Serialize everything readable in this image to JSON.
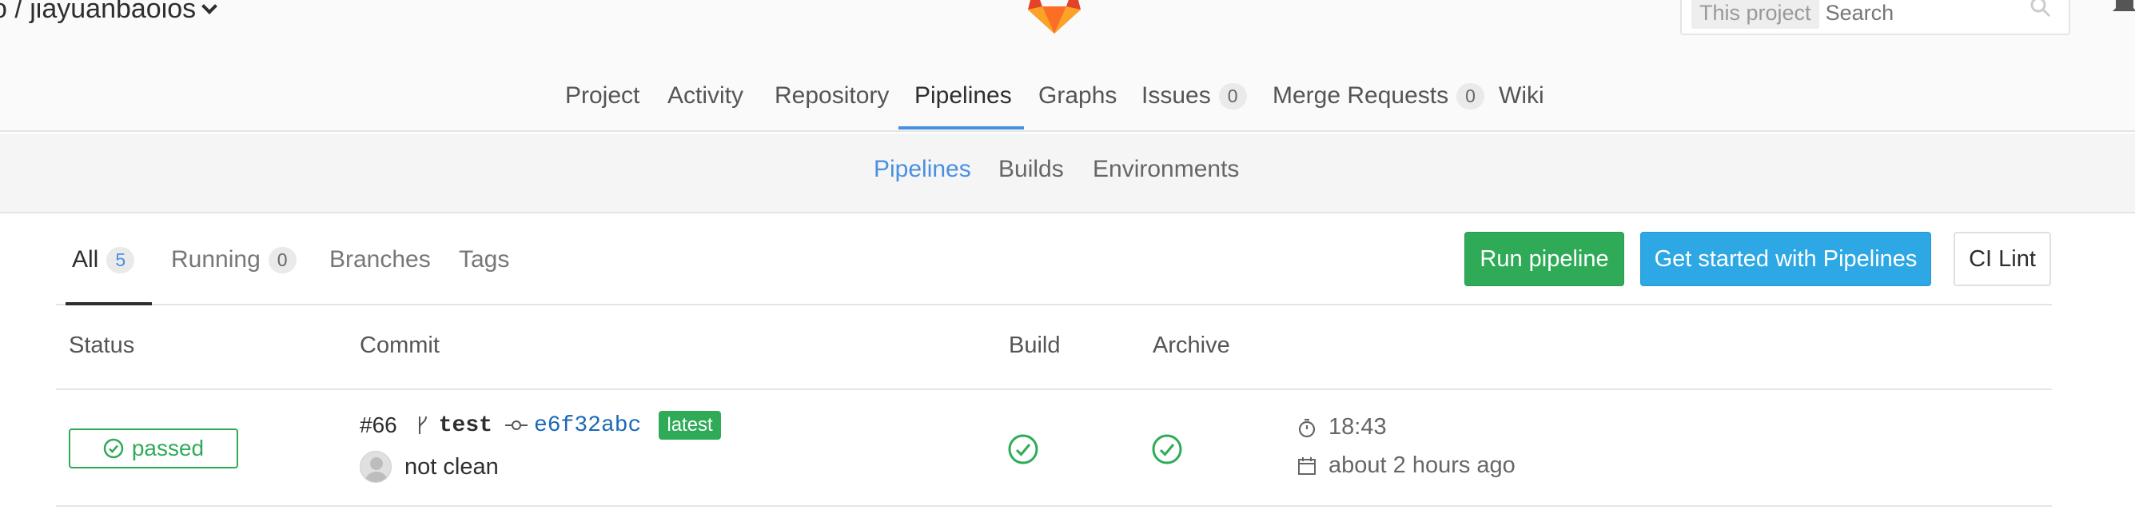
{
  "header": {
    "project_title": "o / jiayuanbaoios",
    "search": {
      "scope": "This project",
      "placeholder": "Search"
    }
  },
  "nav": {
    "items": [
      {
        "label": "Project"
      },
      {
        "label": "Activity"
      },
      {
        "label": "Repository"
      },
      {
        "label": "Pipelines",
        "active": true
      },
      {
        "label": "Graphs"
      },
      {
        "label": "Issues",
        "count": "0"
      },
      {
        "label": "Merge Requests",
        "count": "0"
      },
      {
        "label": "Wiki"
      }
    ]
  },
  "subnav": {
    "items": [
      {
        "label": "Pipelines",
        "active": true
      },
      {
        "label": "Builds"
      },
      {
        "label": "Environments"
      }
    ]
  },
  "tabs": {
    "items": [
      {
        "label": "All",
        "count": "5",
        "active": true
      },
      {
        "label": "Running",
        "count": "0"
      },
      {
        "label": "Branches"
      },
      {
        "label": "Tags"
      }
    ]
  },
  "actions": {
    "run_pipeline": "Run pipeline",
    "get_started": "Get started with Pipelines",
    "ci_lint": "CI Lint"
  },
  "table": {
    "headers": {
      "status": "Status",
      "commit": "Commit",
      "build": "Build",
      "archive": "Archive"
    },
    "rows": [
      {
        "status": "passed",
        "pipeline_id": "#66",
        "branch": "test",
        "sha": "e6f32abc",
        "badge": "latest",
        "message": "not clean",
        "stages": {
          "build": "passed",
          "archive": "passed"
        },
        "duration": "18:43",
        "finished": "about 2 hours ago"
      }
    ]
  },
  "colors": {
    "success": "#2fab58",
    "accent_blue": "#4a90e2",
    "info_button": "#2ea8e5",
    "sha_link": "#1b69b6"
  },
  "icons": [
    "gitlab-logo",
    "search-icon",
    "bell-icon",
    "chevron-down-icon",
    "check-circle-icon",
    "branch-icon",
    "commit-icon",
    "timer-icon",
    "calendar-icon"
  ]
}
